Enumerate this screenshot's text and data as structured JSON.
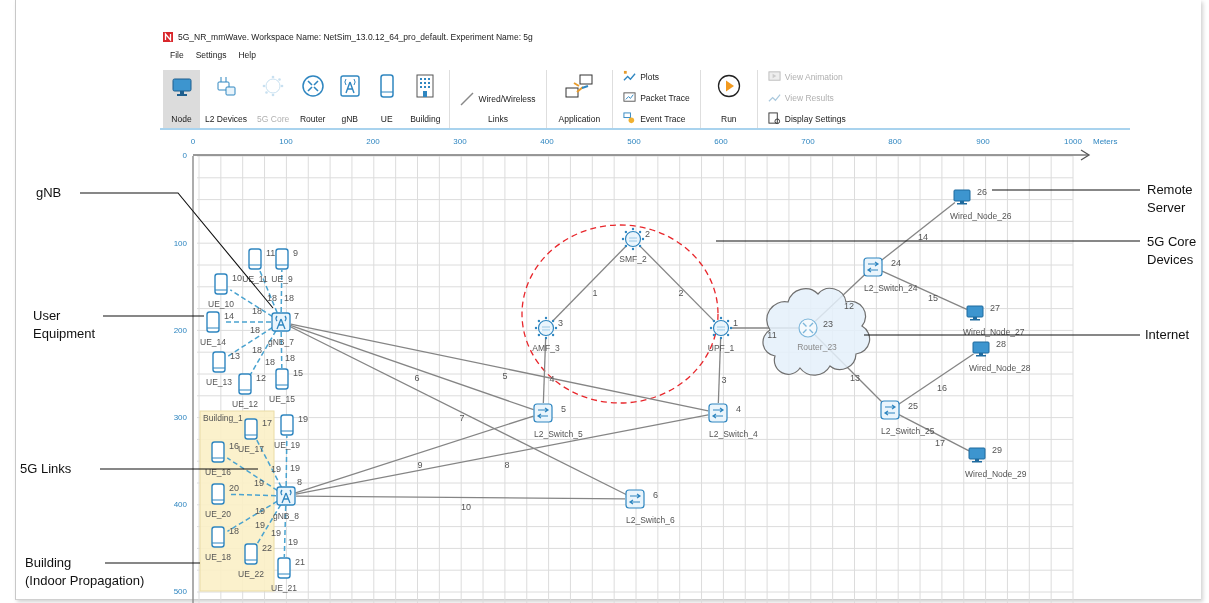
{
  "window": {
    "title": "5G_NR_mmWave. Workspace Name: NetSim_13.0.12_64_pro_default. Experiment Name: 5g"
  },
  "menu": [
    "File",
    "Settings",
    "Help"
  ],
  "toolbar": {
    "device_buttons": [
      {
        "label": "Node",
        "kind": "node",
        "selected": true,
        "disabled": false
      },
      {
        "label": "L2 Devices",
        "kind": "l2",
        "selected": false,
        "disabled": false
      },
      {
        "label": "5G Core",
        "kind": "core",
        "selected": false,
        "disabled": true
      },
      {
        "label": "Router",
        "kind": "router",
        "selected": false,
        "disabled": false
      },
      {
        "label": "gNB",
        "kind": "gnb",
        "selected": false,
        "disabled": false
      },
      {
        "label": "UE",
        "kind": "ue",
        "selected": false,
        "disabled": false
      },
      {
        "label": "Building",
        "kind": "building",
        "selected": false,
        "disabled": false
      }
    ],
    "links": {
      "option": "Wired/Wireless",
      "label": "Links"
    },
    "application": "Application",
    "trace_items": [
      {
        "label": "Plots",
        "kind": "plots"
      },
      {
        "label": "Packet Trace",
        "kind": "packet"
      },
      {
        "label": "Event Trace",
        "kind": "event"
      }
    ],
    "run": "Run",
    "view_items": [
      {
        "label": "View Animation",
        "kind": "animation",
        "disabled": true
      },
      {
        "label": "View Results",
        "kind": "results",
        "disabled": true
      },
      {
        "label": "Display Settings",
        "kind": "display",
        "disabled": false
      }
    ]
  },
  "ruler": {
    "x_ticks": [
      "0",
      "100",
      "200",
      "300",
      "400",
      "500",
      "600",
      "700",
      "800",
      "900",
      "1000"
    ],
    "unit": "Meters",
    "y_ticks": [
      "0",
      "100",
      "200",
      "300",
      "400",
      "500"
    ]
  },
  "canvas": {
    "building": {
      "label": "Building_1"
    },
    "nodes": [
      {
        "label": "gNB_7",
        "number": "7",
        "kind": "gnb"
      },
      {
        "label": "UE_11",
        "number": "11",
        "kind": "ue"
      },
      {
        "label": "UE_9",
        "number": "9",
        "kind": "ue"
      },
      {
        "label": "UE_10",
        "number": "10",
        "kind": "ue"
      },
      {
        "label": "UE_14",
        "number": "14",
        "kind": "ue"
      },
      {
        "label": "UE_13",
        "number": "13",
        "kind": "ue"
      },
      {
        "label": "UE_12",
        "number": "12",
        "kind": "ue"
      },
      {
        "label": "UE_15",
        "number": "15",
        "kind": "ue"
      },
      {
        "label": "gNB_8",
        "number": "8",
        "kind": "gnb"
      },
      {
        "label": "UE_17",
        "number": "17",
        "kind": "ue"
      },
      {
        "label": "UE_19",
        "number": "19",
        "kind": "ue"
      },
      {
        "label": "UE_16",
        "number": "16",
        "kind": "ue"
      },
      {
        "label": "UE_20",
        "number": "20",
        "kind": "ue"
      },
      {
        "label": "UE_18",
        "number": "18",
        "kind": "ue"
      },
      {
        "label": "UE_22",
        "number": "22",
        "kind": "ue"
      },
      {
        "label": "UE_21",
        "number": "21",
        "kind": "ue"
      },
      {
        "label": "SMF_2",
        "number": "2",
        "kind": "core"
      },
      {
        "label": "AMF_3",
        "number": "3",
        "kind": "core"
      },
      {
        "label": "UPF_1",
        "number": "1",
        "kind": "core"
      },
      {
        "label": "L2_Switch_5",
        "number": "5",
        "kind": "switch"
      },
      {
        "label": "L2_Switch_4",
        "number": "4",
        "kind": "switch"
      },
      {
        "label": "L2_Switch_6",
        "number": "6",
        "kind": "switch"
      },
      {
        "label": "Router_23",
        "number": "23",
        "kind": "router"
      },
      {
        "label": "L2_Switch_24",
        "number": "24",
        "kind": "switch"
      },
      {
        "label": "Wired_Node_26",
        "number": "26",
        "kind": "wired"
      },
      {
        "label": "Wired_Node_27",
        "number": "27",
        "kind": "wired"
      },
      {
        "label": "Wired_Node_28",
        "number": "28",
        "kind": "wired"
      },
      {
        "label": "L2_Switch_25",
        "number": "25",
        "kind": "switch"
      },
      {
        "label": "Wired_Node_29",
        "number": "29",
        "kind": "wired"
      }
    ],
    "links": [
      {
        "label": "1",
        "kind": "wired"
      },
      {
        "label": "2",
        "kind": "wired"
      },
      {
        "label": "6",
        "kind": "wired"
      },
      {
        "label": "5",
        "kind": "wired"
      },
      {
        "label": "4",
        "kind": "wired"
      },
      {
        "label": "3",
        "kind": "wired"
      },
      {
        "label": "7",
        "kind": "wired"
      },
      {
        "label": "9",
        "kind": "wired"
      },
      {
        "label": "8",
        "kind": "wired"
      },
      {
        "label": "10",
        "kind": "wired"
      },
      {
        "label": "11",
        "kind": "wired"
      },
      {
        "label": "12",
        "kind": "wired"
      },
      {
        "label": "13",
        "kind": "wired"
      },
      {
        "label": "14",
        "kind": "wired"
      },
      {
        "label": "15",
        "kind": "wired"
      },
      {
        "label": "16",
        "kind": "wired"
      },
      {
        "label": "17",
        "kind": "wired"
      },
      {
        "label": "18",
        "kind": "wireless"
      },
      {
        "label": "18",
        "kind": "wireless"
      },
      {
        "label": "18",
        "kind": "wireless"
      },
      {
        "label": "18",
        "kind": "wireless"
      },
      {
        "label": "18",
        "kind": "wireless"
      },
      {
        "label": "18",
        "kind": "wireless"
      },
      {
        "label": "18",
        "kind": "wireless"
      },
      {
        "label": "19",
        "kind": "wireless"
      },
      {
        "label": "19",
        "kind": "wireless"
      },
      {
        "label": "19",
        "kind": "wireless"
      },
      {
        "label": "19",
        "kind": "wireless"
      },
      {
        "label": "19",
        "kind": "wireless"
      },
      {
        "label": "19",
        "kind": "wireless"
      },
      {
        "label": "19",
        "kind": "wireless"
      }
    ]
  },
  "annotations": [
    {
      "lines": [
        "gNB"
      ]
    },
    {
      "lines": [
        "User",
        "Equipment"
      ]
    },
    {
      "lines": [
        "5G Links"
      ]
    },
    {
      "lines": [
        "Building",
        "(Indoor Propagation)"
      ]
    },
    {
      "lines": [
        "Remote",
        "Server"
      ]
    },
    {
      "lines": [
        "5G Core",
        "Devices"
      ]
    },
    {
      "lines": [
        "Internet"
      ]
    }
  ]
}
